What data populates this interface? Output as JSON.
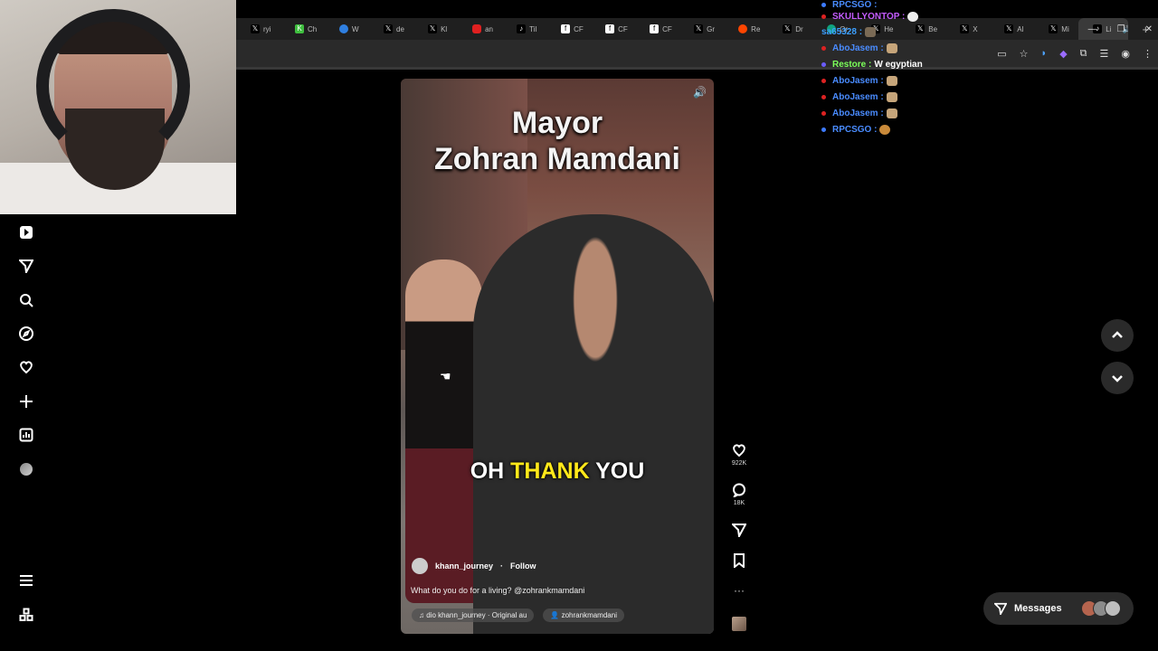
{
  "browser": {
    "tabs": [
      "ryi",
      "Ch",
      "W",
      "de",
      "Kl",
      "an",
      "Til",
      "CF",
      "CF",
      "CF",
      "Gr",
      "Re",
      "Dr",
      "Or",
      "He",
      "Be",
      "X",
      "Al",
      "Mi",
      "Li"
    ],
    "window_controls": [
      "—",
      "❐",
      "✕"
    ],
    "new_tab": "+"
  },
  "video": {
    "title_line1": "Mayor",
    "title_line2": "Zohran Mamdani",
    "caption": {
      "pre": "OH ",
      "highlight": "THANK",
      "post": " YOU"
    },
    "author": "khann_journey",
    "separator": "·",
    "follow": "Follow",
    "description": "What do you do for a living? @zohrankmamdani",
    "sound": "dio   khann_journey · Original au",
    "tagged": "zohrankmamdani",
    "colors": {
      "caption_highlight": "#ffe81a"
    }
  },
  "actions": {
    "likes": "922K",
    "comments": "18K",
    "more": "···"
  },
  "messages": {
    "label": "Messages"
  },
  "chat": [
    {
      "user": "RPCSGO :",
      "text": "",
      "color": "#4a8cff"
    },
    {
      "user": "SKULLYONTOP :",
      "text": "",
      "color": "#c45cff"
    },
    {
      "user": "sa65328 :",
      "text": "",
      "color": "#3da0ff"
    },
    {
      "user": "AboJasem :",
      "text": "",
      "color": "#4a8cff"
    },
    {
      "user": "Restore :",
      "text": "W egyptian",
      "color": "#7cff5a"
    },
    {
      "user": "AboJasem :",
      "text": "",
      "color": "#4a8cff"
    },
    {
      "user": "AboJasem :",
      "text": "",
      "color": "#4a8cff"
    },
    {
      "user": "AboJasem :",
      "text": "",
      "color": "#4a8cff"
    },
    {
      "user": "RPCSGO :",
      "text": "",
      "color": "#4a8cff"
    }
  ]
}
